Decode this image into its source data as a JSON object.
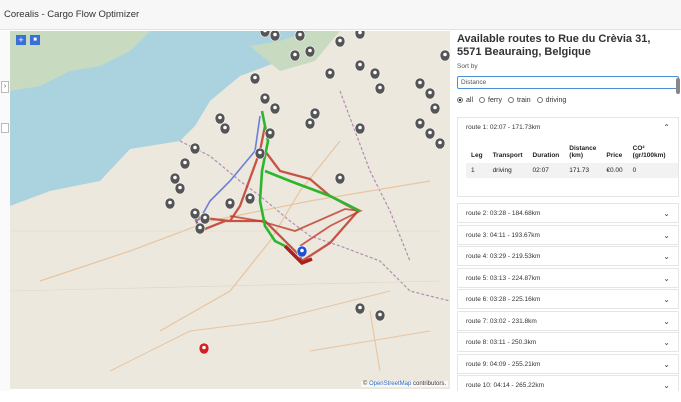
{
  "app": {
    "title": "Corealis - Cargo Flow Optimizer"
  },
  "map": {
    "zoom_in": "+",
    "zoom_out": "■",
    "attribution_prefix": "©",
    "attribution_link": "OpenStreetMap",
    "attribution_suffix": "contributors."
  },
  "sidebar": {
    "toggle_label": "›"
  },
  "panel": {
    "title": "Available routes to Rue du Crèvia 31, 5571 Beauraing, Belgique",
    "sort_label": "Sort by",
    "sort_value": "Distance",
    "filters": [
      {
        "label": "all",
        "checked": true
      },
      {
        "label": "ferry",
        "checked": false
      },
      {
        "label": "train",
        "checked": false
      },
      {
        "label": "driving",
        "checked": false
      }
    ],
    "expanded_route": {
      "label": "route 1: 02:07 - 171.73km",
      "headers": [
        "Leg",
        "Transport",
        "Duration",
        "Distance (km)",
        "Price",
        "CO² (gr/100km)"
      ],
      "rows": [
        [
          "1",
          "driving",
          "02:07",
          "171.73",
          "€0.00",
          "0"
        ]
      ]
    },
    "routes": [
      "route 2: 03:28 - 184.68km",
      "route 3: 04:11 - 193.67km",
      "route 4: 03:29 - 219.53km",
      "route 5: 03:13 - 224.87km",
      "route 6: 03:28 - 225.16km",
      "route 7: 03:02 - 231.8km",
      "route 8: 03:11 - 250.3km",
      "route 9: 04:09 - 255.21km",
      "route 10: 04:14 - 265.22km"
    ]
  },
  "colors": {
    "route_red": "#c0392b",
    "route_green": "#2db52d",
    "route_blue": "#6a7fd8",
    "pin_dark": "#555555",
    "pin_dest": "#1f4fd6",
    "pin_origin": "#d62020"
  }
}
